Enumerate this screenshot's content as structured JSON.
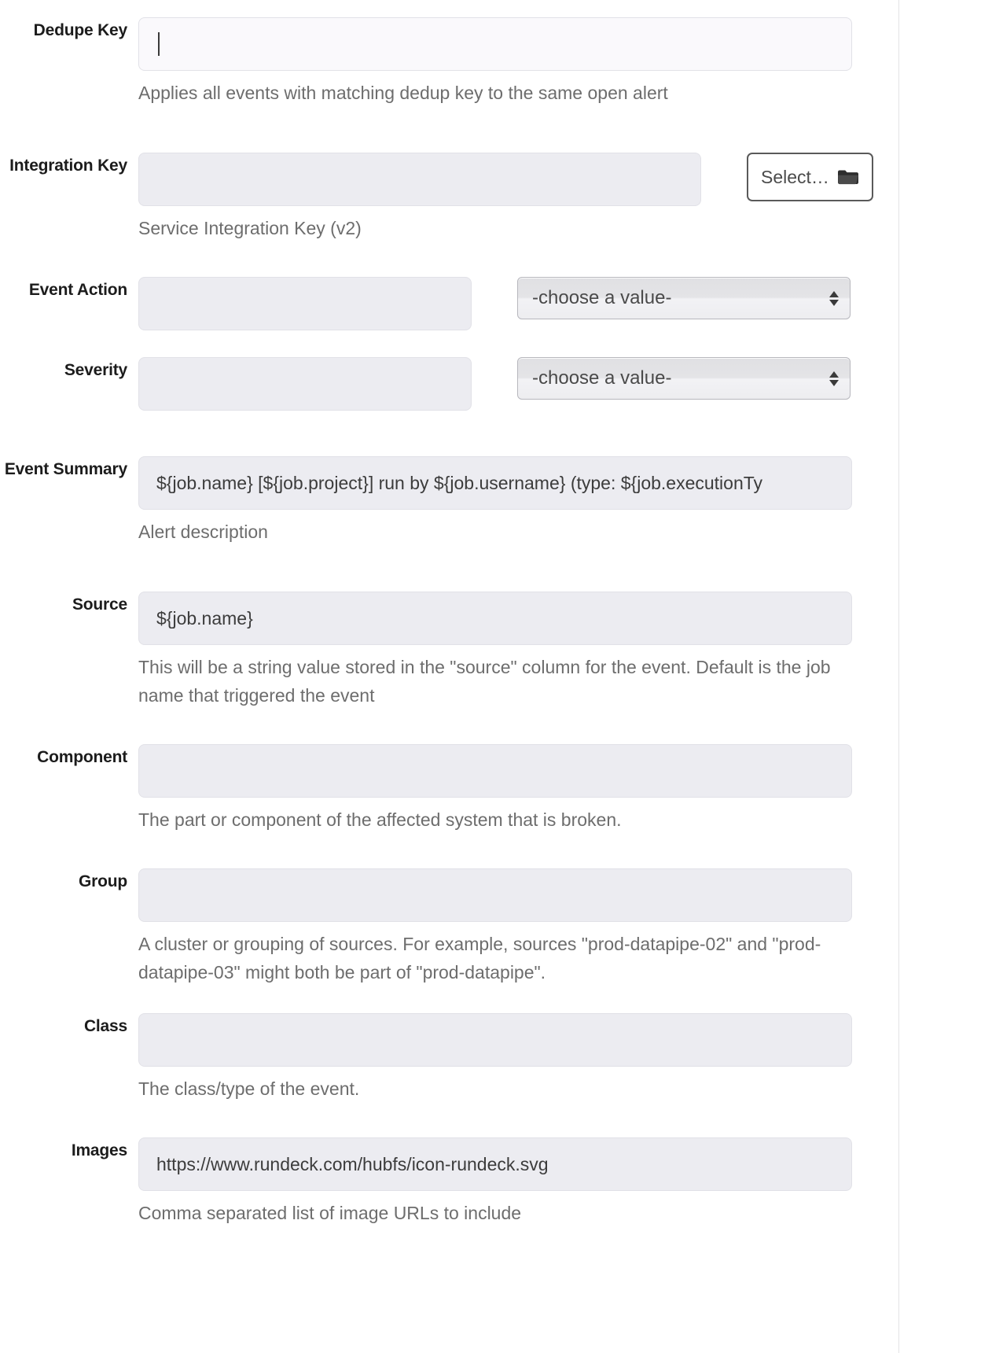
{
  "form": {
    "fields": [
      {
        "label": "Dedupe Key",
        "value": "",
        "help": "Applies all events with matching dedup key to the same open alert",
        "control": "text-focused"
      },
      {
        "label": "Integration Key",
        "value": "",
        "help": "Service Integration Key (v2)",
        "control": "text-with-button",
        "button_label": "Select…",
        "button_icon": "folder-icon"
      },
      {
        "label": "Event Action",
        "value": "",
        "help": "",
        "control": "text-with-select",
        "select_value": "-choose a value-"
      },
      {
        "label": "Severity",
        "value": "",
        "help": "",
        "control": "text-with-select",
        "select_value": "-choose a value-"
      },
      {
        "label": "Event Summary",
        "value": "${job.name} [${job.project}] run by ${job.username} (type: ${job.executionTy",
        "help": "Alert description",
        "control": "text"
      },
      {
        "label": "Source",
        "value": "${job.name}",
        "help": "This will be a string value stored in the \"source\" column for the event. Default is the job name that triggered the event",
        "control": "text"
      },
      {
        "label": "Component",
        "value": "",
        "help": "The part or component of the affected system that is broken.",
        "control": "text"
      },
      {
        "label": "Group",
        "value": "",
        "help": "A cluster or grouping of sources. For example, sources \"prod-datapipe-02\" and \"prod-datapipe-03\" might both be part of \"prod-datapipe\".",
        "control": "text"
      },
      {
        "label": "Class",
        "value": "",
        "help": "The class/type of the event.",
        "control": "text"
      },
      {
        "label": "Images",
        "value": "https://www.rundeck.com/hubfs/icon-rundeck.svg",
        "help": "Comma separated list of image URLs to include",
        "control": "text"
      }
    ]
  },
  "colors": {
    "input_bg": "#ececf1",
    "input_bg_focus": "#faf9fc",
    "input_border": "#e1e1e7",
    "label_text": "#1c1c1c",
    "help_text": "#6d6d6d",
    "value_text": "#3c3c3c",
    "select_border": "#b7b7bd",
    "button_border": "#5a5a5a"
  }
}
